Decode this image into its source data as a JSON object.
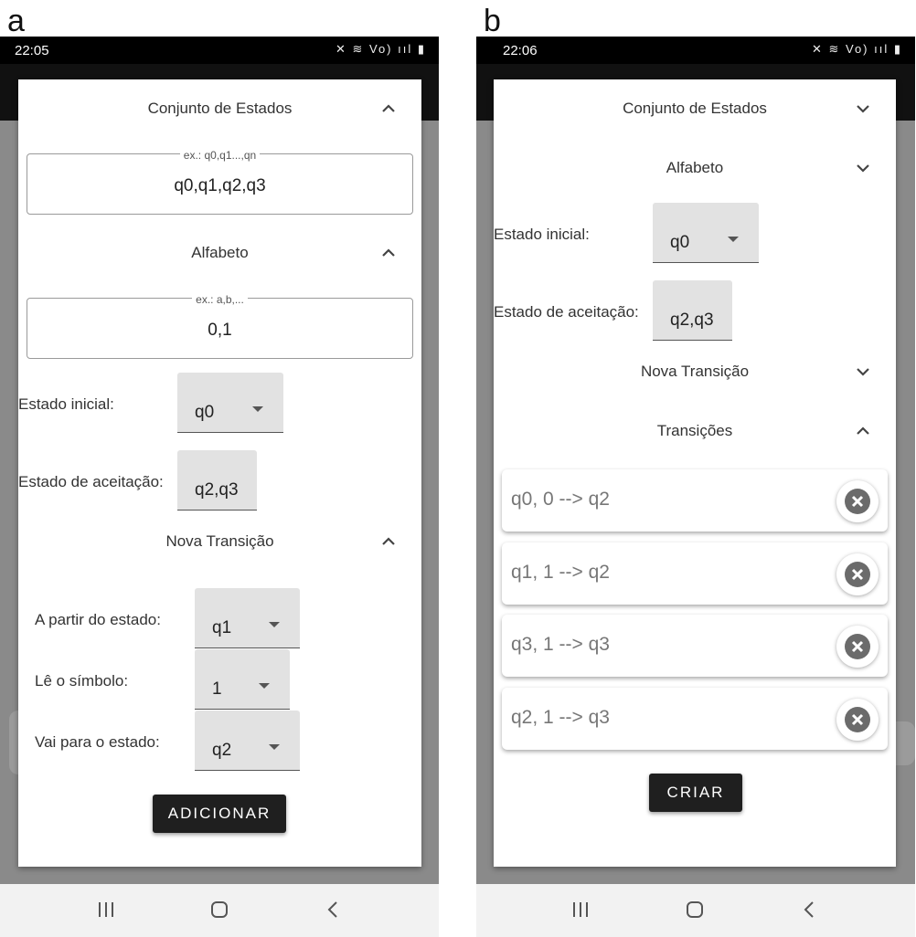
{
  "panels": {
    "a": {
      "letter": "a",
      "time": "22:05",
      "status_icons": "✕ ≋ Vo) ııl ▮",
      "sections": {
        "states_title": "Conjunto de Estados",
        "alphabet_title": "Alfabeto",
        "new_transition_title": "Nova Transição"
      },
      "states_field": {
        "legend": "ex.: q0,q1...,qn",
        "value": "q0,q1,q2,q3"
      },
      "alphabet_field": {
        "legend": "ex.: a,b,...",
        "value": "0,1"
      },
      "initial_state": {
        "label": "Estado inicial:",
        "value": "q0"
      },
      "accept_state": {
        "label": "Estado de aceitação:",
        "value": "q2,q3"
      },
      "from_state": {
        "label": "A partir do estado:",
        "value": "q1"
      },
      "read_symbol": {
        "label": "Lê o símbolo:",
        "value": "1"
      },
      "to_state": {
        "label": "Vai para o estado:",
        "value": "q2"
      },
      "add_button": "ADICIONAR"
    },
    "b": {
      "letter": "b",
      "time": "22:06",
      "status_icons": "✕ ≋ Vo) ııl ▮",
      "sections": {
        "states_title": "Conjunto de Estados",
        "alphabet_title": "Alfabeto",
        "new_transition_title": "Nova Transição",
        "transitions_title": "Transições"
      },
      "initial_state": {
        "label": "Estado inicial:",
        "value": "q0"
      },
      "accept_state": {
        "label": "Estado de aceitação:",
        "value": "q2,q3"
      },
      "transitions": [
        "q0, 0 --> q2",
        "q1, 1 --> q2",
        "q3, 1 --> q3",
        "q2, 1 --> q3"
      ],
      "create_button": "CRIAR"
    }
  },
  "colors": {
    "accent": "#1f1f1f",
    "delete_icon": "#6b6b6b",
    "scrim": "#8a8a8a"
  }
}
